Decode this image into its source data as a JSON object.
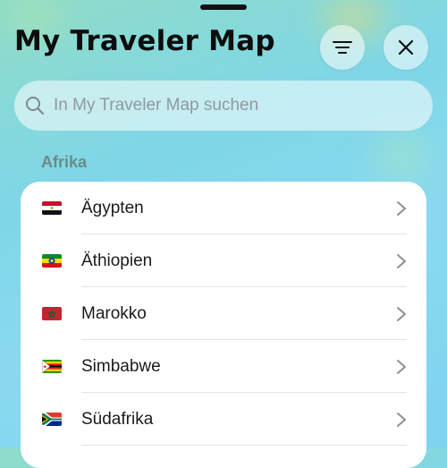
{
  "app": {
    "title": "My Traveler Map"
  },
  "header": {
    "filter_icon": "filter-lines-icon",
    "close_icon": "close-x-icon"
  },
  "search": {
    "placeholder": "In My Traveler Map suchen",
    "value": ""
  },
  "sections": [
    {
      "title": "Afrika",
      "items": [
        {
          "label": "Ägypten",
          "flag": "egypt-flag"
        },
        {
          "label": "Äthiopien",
          "flag": "ethiopia-flag"
        },
        {
          "label": "Marokko",
          "flag": "morocco-flag"
        },
        {
          "label": "Simbabwe",
          "flag": "zimbabwe-flag"
        },
        {
          "label": "Südafrika",
          "flag": "south-africa-flag"
        }
      ]
    }
  ],
  "colors": {
    "section_header": "#6d8a88",
    "card": "#ffffff",
    "title": "#0d0d0d"
  }
}
